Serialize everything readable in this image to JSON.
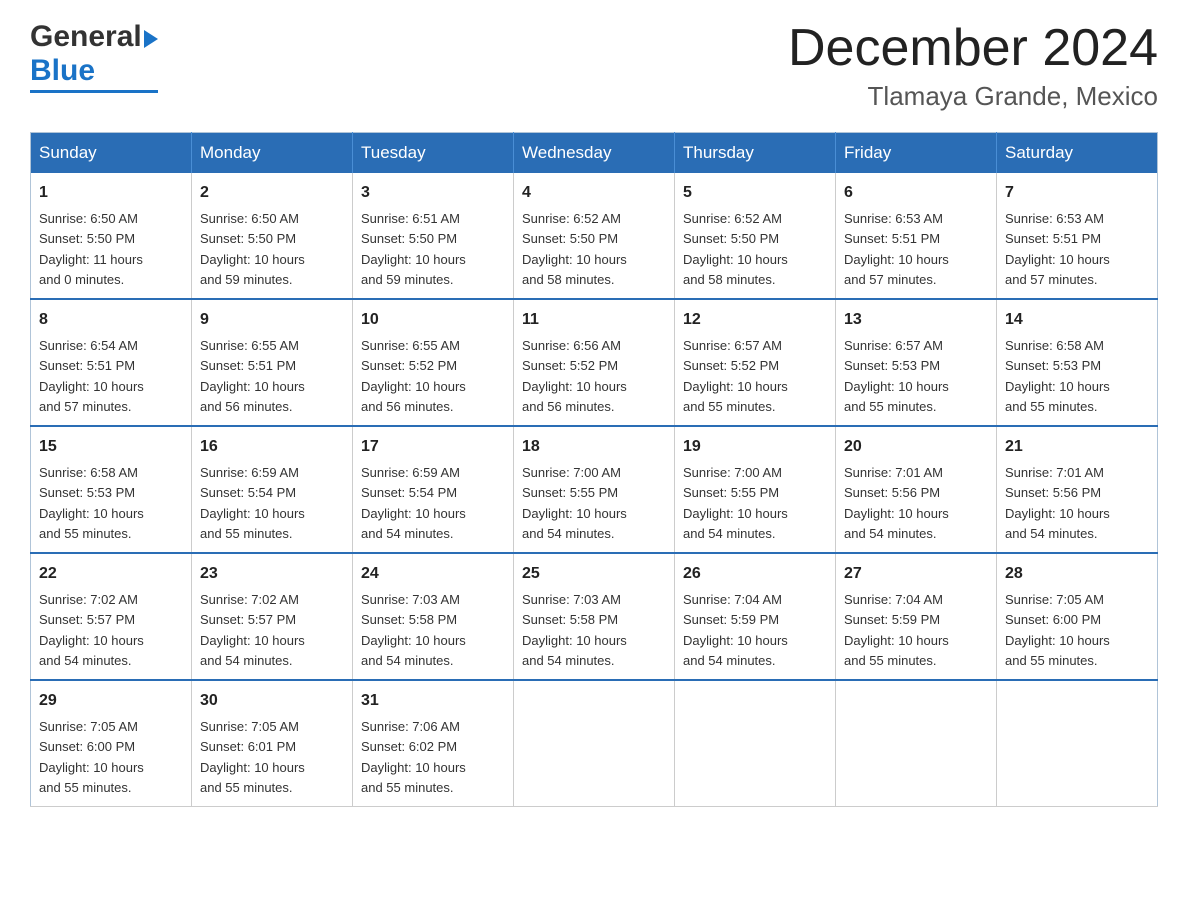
{
  "header": {
    "logo_line1": "General",
    "logo_line2": "Blue",
    "title": "December 2024",
    "subtitle": "Tlamaya Grande, Mexico"
  },
  "calendar": {
    "weekdays": [
      "Sunday",
      "Monday",
      "Tuesday",
      "Wednesday",
      "Thursday",
      "Friday",
      "Saturday"
    ],
    "weeks": [
      [
        {
          "day": "1",
          "sunrise": "6:50 AM",
          "sunset": "5:50 PM",
          "daylight": "11 hours and 0 minutes."
        },
        {
          "day": "2",
          "sunrise": "6:50 AM",
          "sunset": "5:50 PM",
          "daylight": "10 hours and 59 minutes."
        },
        {
          "day": "3",
          "sunrise": "6:51 AM",
          "sunset": "5:50 PM",
          "daylight": "10 hours and 59 minutes."
        },
        {
          "day": "4",
          "sunrise": "6:52 AM",
          "sunset": "5:50 PM",
          "daylight": "10 hours and 58 minutes."
        },
        {
          "day": "5",
          "sunrise": "6:52 AM",
          "sunset": "5:50 PM",
          "daylight": "10 hours and 58 minutes."
        },
        {
          "day": "6",
          "sunrise": "6:53 AM",
          "sunset": "5:51 PM",
          "daylight": "10 hours and 57 minutes."
        },
        {
          "day": "7",
          "sunrise": "6:53 AM",
          "sunset": "5:51 PM",
          "daylight": "10 hours and 57 minutes."
        }
      ],
      [
        {
          "day": "8",
          "sunrise": "6:54 AM",
          "sunset": "5:51 PM",
          "daylight": "10 hours and 57 minutes."
        },
        {
          "day": "9",
          "sunrise": "6:55 AM",
          "sunset": "5:51 PM",
          "daylight": "10 hours and 56 minutes."
        },
        {
          "day": "10",
          "sunrise": "6:55 AM",
          "sunset": "5:52 PM",
          "daylight": "10 hours and 56 minutes."
        },
        {
          "day": "11",
          "sunrise": "6:56 AM",
          "sunset": "5:52 PM",
          "daylight": "10 hours and 56 minutes."
        },
        {
          "day": "12",
          "sunrise": "6:57 AM",
          "sunset": "5:52 PM",
          "daylight": "10 hours and 55 minutes."
        },
        {
          "day": "13",
          "sunrise": "6:57 AM",
          "sunset": "5:53 PM",
          "daylight": "10 hours and 55 minutes."
        },
        {
          "day": "14",
          "sunrise": "6:58 AM",
          "sunset": "5:53 PM",
          "daylight": "10 hours and 55 minutes."
        }
      ],
      [
        {
          "day": "15",
          "sunrise": "6:58 AM",
          "sunset": "5:53 PM",
          "daylight": "10 hours and 55 minutes."
        },
        {
          "day": "16",
          "sunrise": "6:59 AM",
          "sunset": "5:54 PM",
          "daylight": "10 hours and 55 minutes."
        },
        {
          "day": "17",
          "sunrise": "6:59 AM",
          "sunset": "5:54 PM",
          "daylight": "10 hours and 54 minutes."
        },
        {
          "day": "18",
          "sunrise": "7:00 AM",
          "sunset": "5:55 PM",
          "daylight": "10 hours and 54 minutes."
        },
        {
          "day": "19",
          "sunrise": "7:00 AM",
          "sunset": "5:55 PM",
          "daylight": "10 hours and 54 minutes."
        },
        {
          "day": "20",
          "sunrise": "7:01 AM",
          "sunset": "5:56 PM",
          "daylight": "10 hours and 54 minutes."
        },
        {
          "day": "21",
          "sunrise": "7:01 AM",
          "sunset": "5:56 PM",
          "daylight": "10 hours and 54 minutes."
        }
      ],
      [
        {
          "day": "22",
          "sunrise": "7:02 AM",
          "sunset": "5:57 PM",
          "daylight": "10 hours and 54 minutes."
        },
        {
          "day": "23",
          "sunrise": "7:02 AM",
          "sunset": "5:57 PM",
          "daylight": "10 hours and 54 minutes."
        },
        {
          "day": "24",
          "sunrise": "7:03 AM",
          "sunset": "5:58 PM",
          "daylight": "10 hours and 54 minutes."
        },
        {
          "day": "25",
          "sunrise": "7:03 AM",
          "sunset": "5:58 PM",
          "daylight": "10 hours and 54 minutes."
        },
        {
          "day": "26",
          "sunrise": "7:04 AM",
          "sunset": "5:59 PM",
          "daylight": "10 hours and 54 minutes."
        },
        {
          "day": "27",
          "sunrise": "7:04 AM",
          "sunset": "5:59 PM",
          "daylight": "10 hours and 55 minutes."
        },
        {
          "day": "28",
          "sunrise": "7:05 AM",
          "sunset": "6:00 PM",
          "daylight": "10 hours and 55 minutes."
        }
      ],
      [
        {
          "day": "29",
          "sunrise": "7:05 AM",
          "sunset": "6:00 PM",
          "daylight": "10 hours and 55 minutes."
        },
        {
          "day": "30",
          "sunrise": "7:05 AM",
          "sunset": "6:01 PM",
          "daylight": "10 hours and 55 minutes."
        },
        {
          "day": "31",
          "sunrise": "7:06 AM",
          "sunset": "6:02 PM",
          "daylight": "10 hours and 55 minutes."
        },
        null,
        null,
        null,
        null
      ]
    ]
  },
  "labels": {
    "sunrise": "Sunrise:",
    "sunset": "Sunset:",
    "daylight": "Daylight:"
  }
}
